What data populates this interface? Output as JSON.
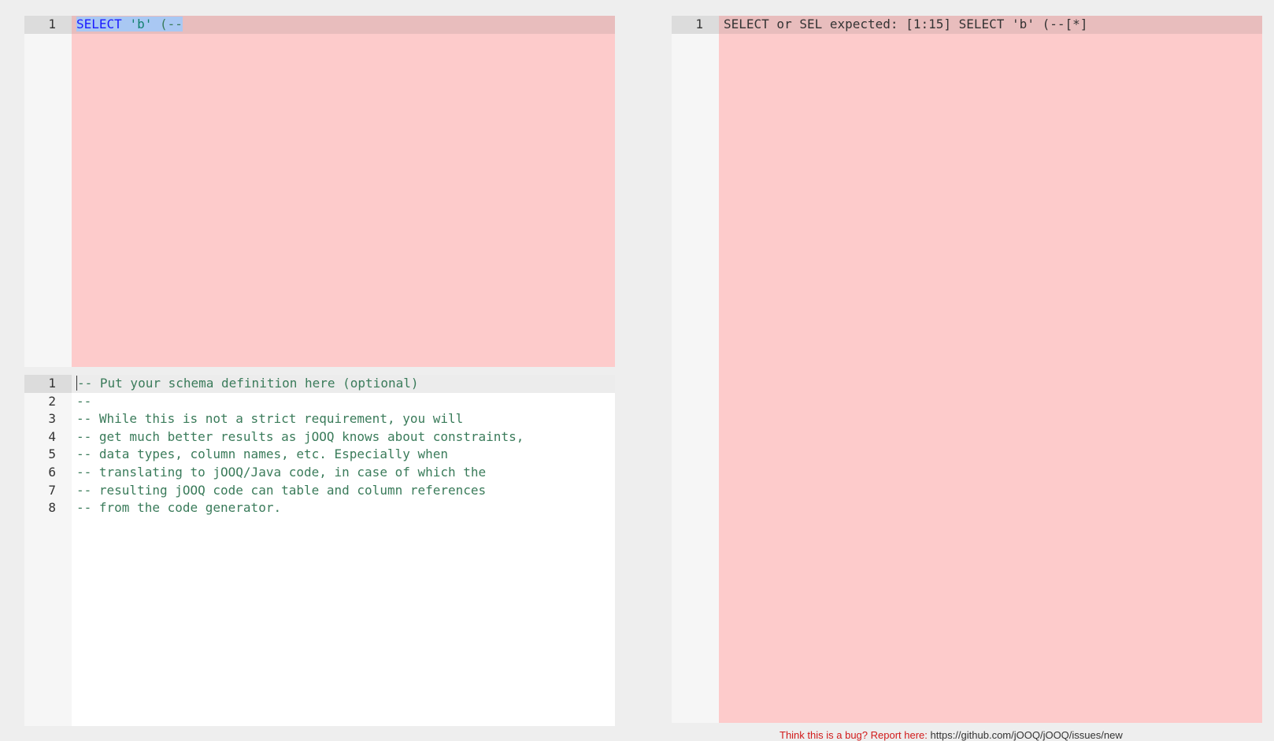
{
  "query_editor": {
    "lines": [
      {
        "num": "1",
        "kw": "SELECT",
        "str": "'b'",
        "rest": "(--"
      }
    ]
  },
  "schema_editor": {
    "lines": [
      {
        "num": "1",
        "text": "-- Put your schema definition here (optional)"
      },
      {
        "num": "2",
        "text": "--"
      },
      {
        "num": "3",
        "text": "-- While this is not a strict requirement, you will"
      },
      {
        "num": "4",
        "text": "-- get much better results as jOOQ knows about constraints,"
      },
      {
        "num": "5",
        "text": "-- data types, column names, etc. Especially when"
      },
      {
        "num": "6",
        "text": "-- translating to jOOQ/Java code, in case of which the"
      },
      {
        "num": "7",
        "text": "-- resulting jOOQ code can table and column references"
      },
      {
        "num": "8",
        "text": "-- from the code generator."
      }
    ]
  },
  "output_editor": {
    "lines": [
      {
        "num": "1",
        "text": "SELECT or SEL expected: [1:15] SELECT 'b' (--[*]"
      }
    ]
  },
  "footer": {
    "label": "Think this is a bug? Report here:",
    "url": "https://github.com/jOOQ/jOOQ/issues/new"
  },
  "colors": {
    "error_background": "#fdcbcb",
    "active_line_error": "#e8bdbd",
    "keyword": "#1a1aa6",
    "string": "#12806f",
    "comment": "#3a7b5a"
  }
}
